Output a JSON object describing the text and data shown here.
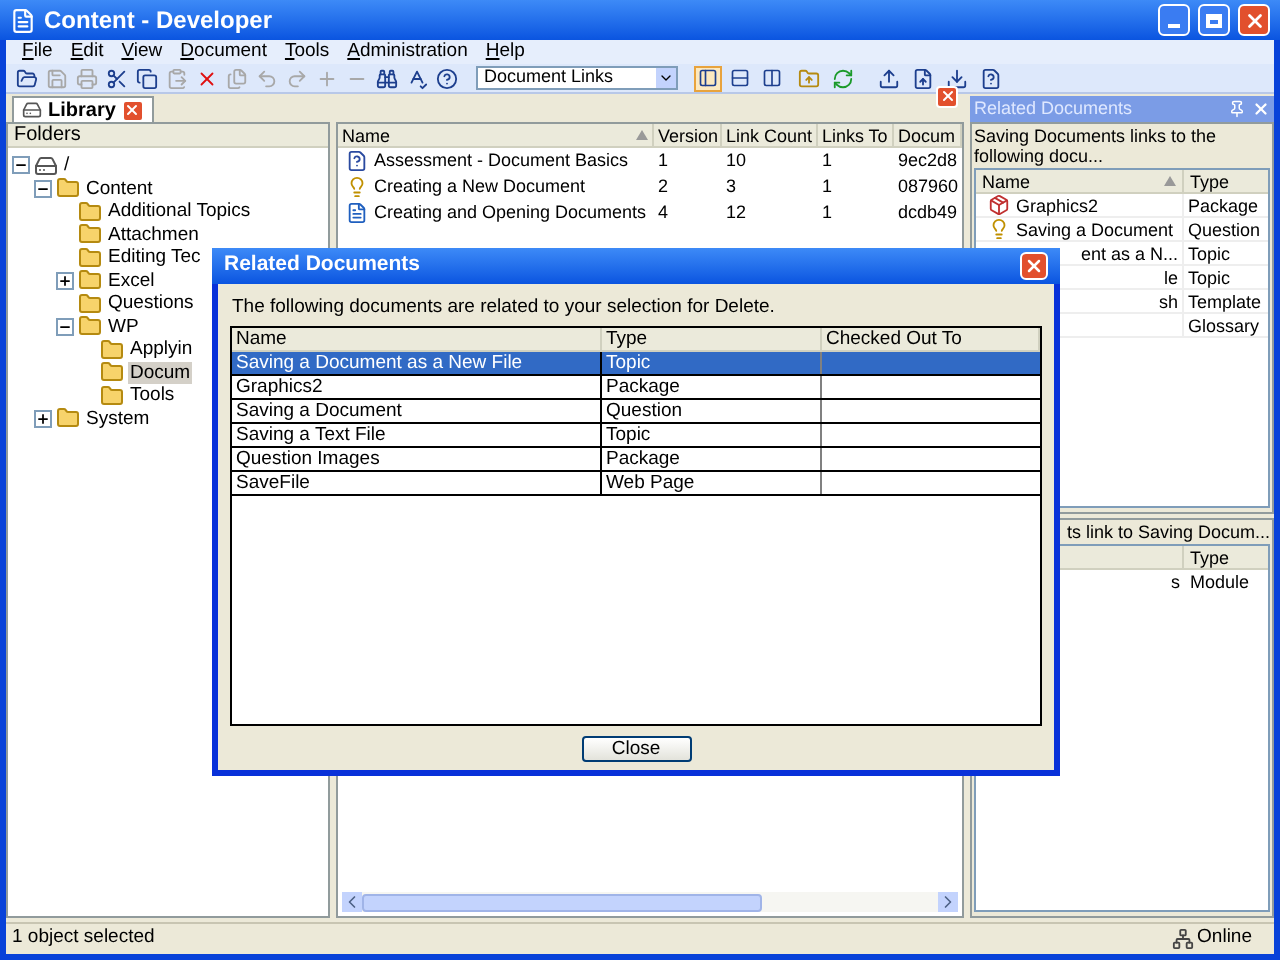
{
  "window": {
    "title": "Content - Developer"
  },
  "menu": [
    "File",
    "Edit",
    "View",
    "Document",
    "Tools",
    "Administration",
    "Help"
  ],
  "toolbar": {
    "buttons": [
      {
        "disabled": false
      },
      {
        "disabled": true
      },
      {
        "disabled": true
      },
      {
        "disabled": false
      },
      {
        "disabled": false
      },
      {
        "disabled": true
      },
      {
        "disabled": false
      },
      {
        "disabled": true
      },
      {
        "disabled": true
      },
      {
        "disabled": true
      },
      {
        "disabled": true
      },
      {
        "disabled": true
      },
      {
        "disabled": false
      },
      {
        "disabled": false
      },
      {
        "disabled": false
      }
    ],
    "view": {
      "value": "Document Links"
    },
    "layout_buttons": [
      {
        "selected": true
      },
      {
        "selected": false
      },
      {
        "selected": false
      }
    ]
  },
  "tabs": [
    {
      "label": "Library",
      "selected": true
    }
  ],
  "folders": {
    "header": "Folders",
    "tree": [
      {
        "label": "/",
        "expanded": true,
        "selected": false,
        "children": [
          {
            "label": "Content",
            "expanded": true,
            "selected": false,
            "children": [
              {
                "label": "Additional Topics",
                "selected": false
              },
              {
                "label": "Attachmen",
                "selected": false
              },
              {
                "label": "Editing Tec",
                "selected": false
              },
              {
                "label": "Excel",
                "expanded": false,
                "selected": false
              },
              {
                "label": "Questions",
                "selected": false
              },
              {
                "label": "WP",
                "expanded": true,
                "selected": false,
                "children": [
                  {
                    "label": "Applyin",
                    "selected": false
                  },
                  {
                    "label": "Docum",
                    "selected": true
                  },
                  {
                    "label": "Tools",
                    "selected": false
                  }
                ]
              }
            ]
          },
          {
            "label": "System",
            "expanded": false,
            "selected": false
          }
        ]
      }
    ]
  },
  "documents": {
    "columns": [
      "Name",
      "Version",
      "Link Count",
      "Links To",
      "Docum"
    ],
    "rows": [
      {
        "kind": "assessment",
        "cells": [
          "Assessment - Document Basics",
          "1",
          "10",
          "1",
          "9ec2d8"
        ]
      },
      {
        "kind": "question",
        "cells": [
          "Creating a New Document",
          "2",
          "3",
          "1",
          "087960"
        ]
      },
      {
        "kind": "topic",
        "cells": [
          "Creating and Opening Documents",
          "4",
          "12",
          "1",
          "dcdb49"
        ]
      }
    ]
  },
  "related": {
    "title": "Related Documents",
    "caption": "Saving Documents links to the following docu...",
    "columns": [
      "Name",
      "Type"
    ],
    "rows": [
      {
        "name": "Graphics2",
        "type": "Package",
        "covered": false,
        "kind": "package"
      },
      {
        "name": "Saving a Document",
        "type": "Question",
        "covered": false,
        "kind": "question"
      },
      {
        "name": "ent as a N...",
        "type": "Topic",
        "covered": true
      },
      {
        "name": "le",
        "type": "Topic",
        "covered": true
      },
      {
        "name": "sh",
        "type": "Template",
        "covered": true
      },
      {
        "type": "Glossary"
      }
    ]
  },
  "related_lower": {
    "caption": "ts link to Saving Docum...",
    "columns": [
      "Type"
    ],
    "rows": [
      {
        "name": "s",
        "type": "Module",
        "covered": true
      }
    ]
  },
  "dialog": {
    "title": "Related Documents",
    "message": "The following documents are related to your selection for Delete.",
    "columns": [
      "Name",
      "Type",
      "Checked Out To"
    ],
    "rows": [
      {
        "name": "Saving a Document as a New File",
        "type": "Topic",
        "selected": true
      },
      {
        "name": "Graphics2",
        "type": "Package",
        "selected": false
      },
      {
        "name": "Saving a Document",
        "type": "Question",
        "selected": false
      },
      {
        "name": "Saving a Text File",
        "type": "Topic",
        "selected": false
      },
      {
        "name": "Question Images",
        "type": "Package",
        "selected": false
      },
      {
        "name": "SaveFile",
        "type": "Web Page",
        "selected": false
      }
    ],
    "button": "Close"
  },
  "status_bar": {
    "text": "1 object selected",
    "connection": "Online"
  }
}
